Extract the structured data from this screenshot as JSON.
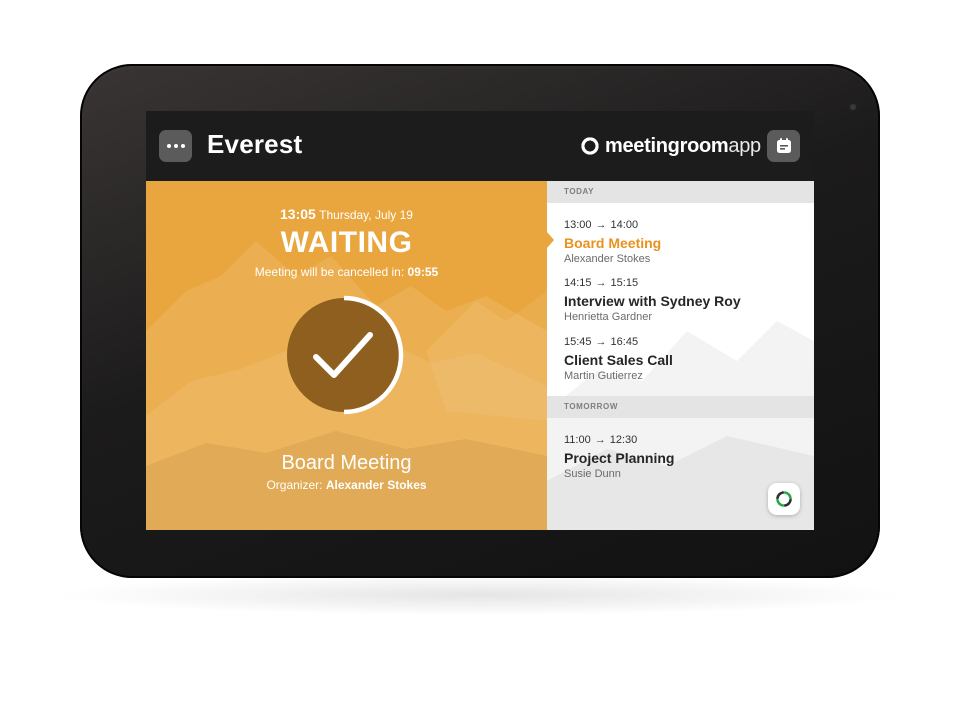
{
  "header": {
    "room_name": "Everest",
    "brand_bold": "meetingroom",
    "brand_light": "app"
  },
  "current": {
    "time": "13:05",
    "date": "Thursday, July 19",
    "status": "WAITING",
    "cancel_prefix": "Meeting will be cancelled in:",
    "countdown": "09:55",
    "meeting_title": "Board Meeting",
    "organizer_label": "Organizer:",
    "organizer": "Alexander Stokes"
  },
  "schedule": {
    "today_label": "TODAY",
    "today": [
      {
        "start": "13:00",
        "end": "14:00",
        "title": "Board Meeting",
        "organizer": "Alexander Stokes"
      },
      {
        "start": "14:15",
        "end": "15:15",
        "title": "Interview with Sydney Roy",
        "organizer": "Henrietta Gardner"
      },
      {
        "start": "15:45",
        "end": "16:45",
        "title": "Client Sales Call",
        "organizer": "Martin Gutierrez"
      }
    ],
    "tomorrow_label": "TOMORROW",
    "tomorrow": [
      {
        "start": "11:00",
        "end": "12:30",
        "title": "Project Planning",
        "organizer": "Susie Dunn"
      }
    ]
  },
  "colors": {
    "accent": "#e8921f",
    "panel": "#e9a63e",
    "timer_fill": "#8f5f20"
  },
  "icons": {
    "menu": "more-dots-icon",
    "calendar": "calendar-icon",
    "status": "checkmark-icon",
    "arrow": "arrow-right-icon",
    "help": "support-icon"
  }
}
